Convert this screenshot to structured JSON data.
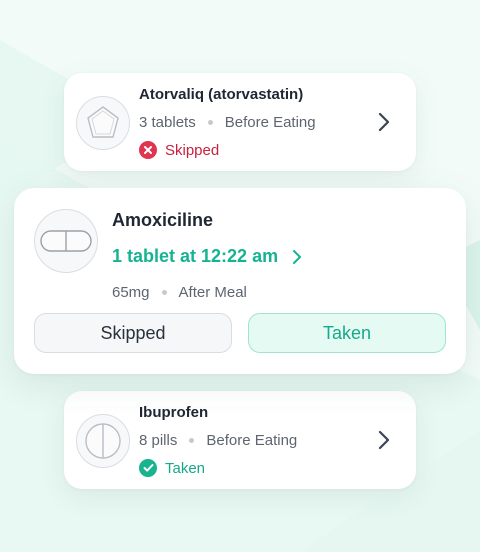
{
  "medications": [
    {
      "name": "Atorvaliq (atorvastatin)",
      "quantity": "3 tablets",
      "timing": "Before Eating",
      "status": "Skipped",
      "icon": "pentagon-pill-icon"
    },
    {
      "name": "Amoxiciline",
      "dose": "1 tablet at 12:22 am",
      "strength": "65mg",
      "timing": "After Meal",
      "skip_label": "Skipped",
      "taken_label": "Taken",
      "icon": "capsule-icon"
    },
    {
      "name": "Ibuprofen",
      "quantity": "8 pills",
      "timing": "Before Eating",
      "status": "Taken",
      "icon": "round-tablet-icon"
    }
  ],
  "colors": {
    "accent": "#16b392",
    "skipped": "#e1344f",
    "background": "#f2fbf8"
  }
}
